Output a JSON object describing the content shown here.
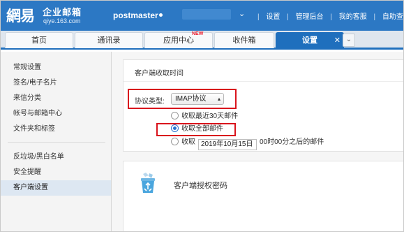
{
  "header": {
    "logo_mark": "網易",
    "logo_name": "企业邮箱",
    "logo_domain": "qiye.163.com",
    "account": "postmaster",
    "top_links": [
      "设置",
      "管理后台",
      "我的客服",
      "自助查询"
    ]
  },
  "tabs": [
    {
      "label": "首页"
    },
    {
      "label": "通讯录"
    },
    {
      "label": "应用中心",
      "badge": "NEW"
    },
    {
      "label": "收件箱"
    },
    {
      "label": "设置",
      "active": true
    }
  ],
  "sidebar": {
    "items": [
      {
        "label": "常规设置"
      },
      {
        "label": "签名/电子名片"
      },
      {
        "label": "来信分类"
      },
      {
        "label": "帐号与邮箱中心"
      },
      {
        "label": "文件夹和标签"
      },
      {
        "label": "反垃圾/黑白名单"
      },
      {
        "label": "安全提醒"
      },
      {
        "label": "客户端设置",
        "active": true
      }
    ]
  },
  "receive_settings": {
    "title": "客户端收取时间",
    "protocol_label": "协议类型:",
    "protocol_value": "IMAP协议",
    "options": [
      {
        "label": "收取最近30天邮件",
        "checked": false
      },
      {
        "label": "收取全部邮件",
        "checked": true
      },
      {
        "label_prefix": "收取",
        "date": "2019年10月15日",
        "label_suffix": "00时00分之后的邮件",
        "checked": false
      }
    ]
  },
  "auth_password": {
    "title": "客户端授权密码"
  },
  "colors": {
    "brand_blue": "#2c78c4",
    "highlight_red": "#d9131c"
  }
}
